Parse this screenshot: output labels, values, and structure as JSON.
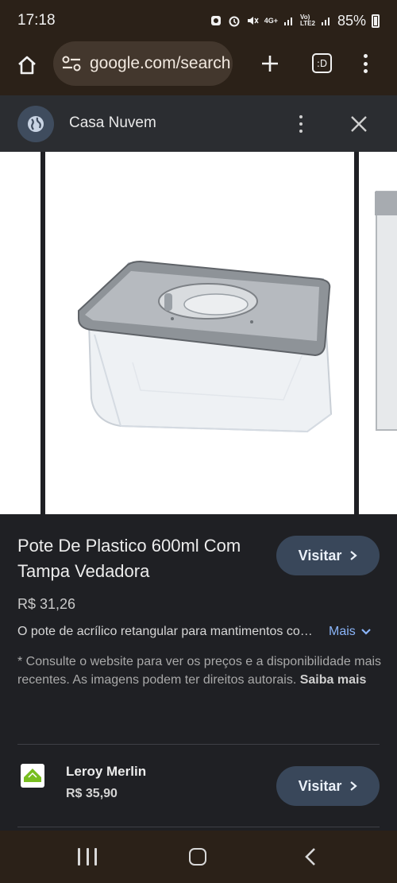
{
  "status": {
    "time": "17:18",
    "network": "4G+",
    "volte": "VoLTE2",
    "battery": "85%"
  },
  "browser": {
    "url": "google.com/search",
    "tab_label": ":D"
  },
  "panel": {
    "site_name": "Casa Nuvem"
  },
  "product": {
    "title": "Pote De Plastico 600ml Com Tampa Vedadora",
    "visit_label": "Visitar",
    "price": "R$ 31,26",
    "description": "O pote de acrílico retangular para mantimentos com tampa vedadora",
    "more_label": "Mais",
    "disclaimer": "* Consulte o website para ver os preços e a disponibilidade mais recentes. As imagens podem ter direitos autorais. ",
    "disclaimer_link": "Saiba mais"
  },
  "merchant": {
    "name": "Leroy Merlin",
    "price": "R$ 35,90",
    "visit_label": "Visitar",
    "logo_color": "#78be20"
  },
  "colors": {
    "accent_link": "#8ab4f8",
    "visit_button": "#39475a"
  }
}
